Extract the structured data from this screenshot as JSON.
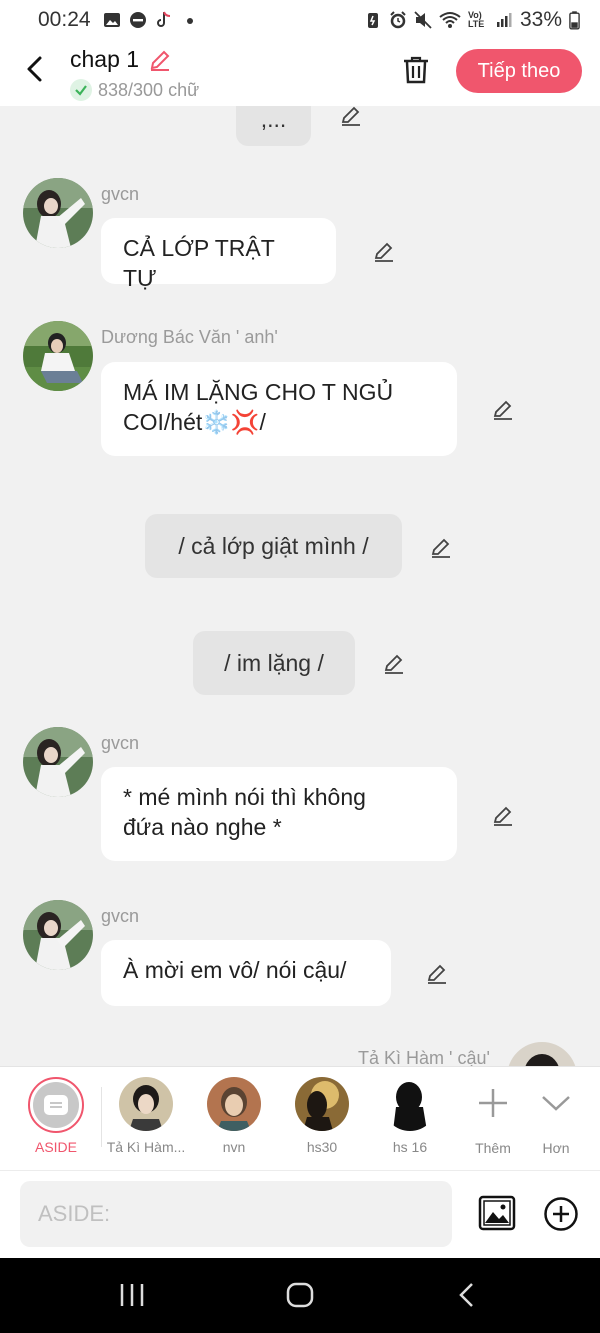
{
  "status_bar": {
    "time": "00:24",
    "battery": "33%",
    "network_label": "Vo) LTE"
  },
  "header": {
    "title": "chap 1",
    "word_count": "838/300 chữ",
    "next_button": "Tiếp theo"
  },
  "colors": {
    "accent": "#f0566d",
    "bubble_bg": "#ffffff",
    "narration_bg": "#e4e4e4",
    "chat_bg": "#f1f1f1"
  },
  "messages": [
    {
      "type": "narration",
      "text": ",..."
    },
    {
      "type": "speech",
      "name": "gvcn",
      "text": "CẢ LỚP TRẬT TỰ"
    },
    {
      "type": "speech",
      "name": "Dương Bác Văn ' anh'",
      "lines": [
        "MÁ IM LẶNG CHO T NGỦ",
        "COI/hét❄️💢/"
      ]
    },
    {
      "type": "narration",
      "text": "/ cả lớp giật mình /"
    },
    {
      "type": "narration",
      "text": "/ im lặng /"
    },
    {
      "type": "speech",
      "name": "gvcn",
      "lines": [
        "* mé mình nói thì không",
        "đứa nào nghe *"
      ]
    },
    {
      "type": "speech",
      "name": "gvcn",
      "text": "À mời em vô/ nói cậu/"
    },
    {
      "type": "speech",
      "name": "Tả Kì Hàm ' cậu'",
      "text": ""
    }
  ],
  "characters": [
    {
      "label": "ASIDE",
      "selected": true
    },
    {
      "label": "Tả Kì Hàm..."
    },
    {
      "label": "nvn"
    },
    {
      "label": "hs30"
    },
    {
      "label": "hs 16"
    },
    {
      "label": "Thêm",
      "icon": "plus-icon"
    },
    {
      "label": "Hơn",
      "icon": "chevron-down-icon"
    }
  ],
  "input": {
    "placeholder": "ASIDE:"
  }
}
